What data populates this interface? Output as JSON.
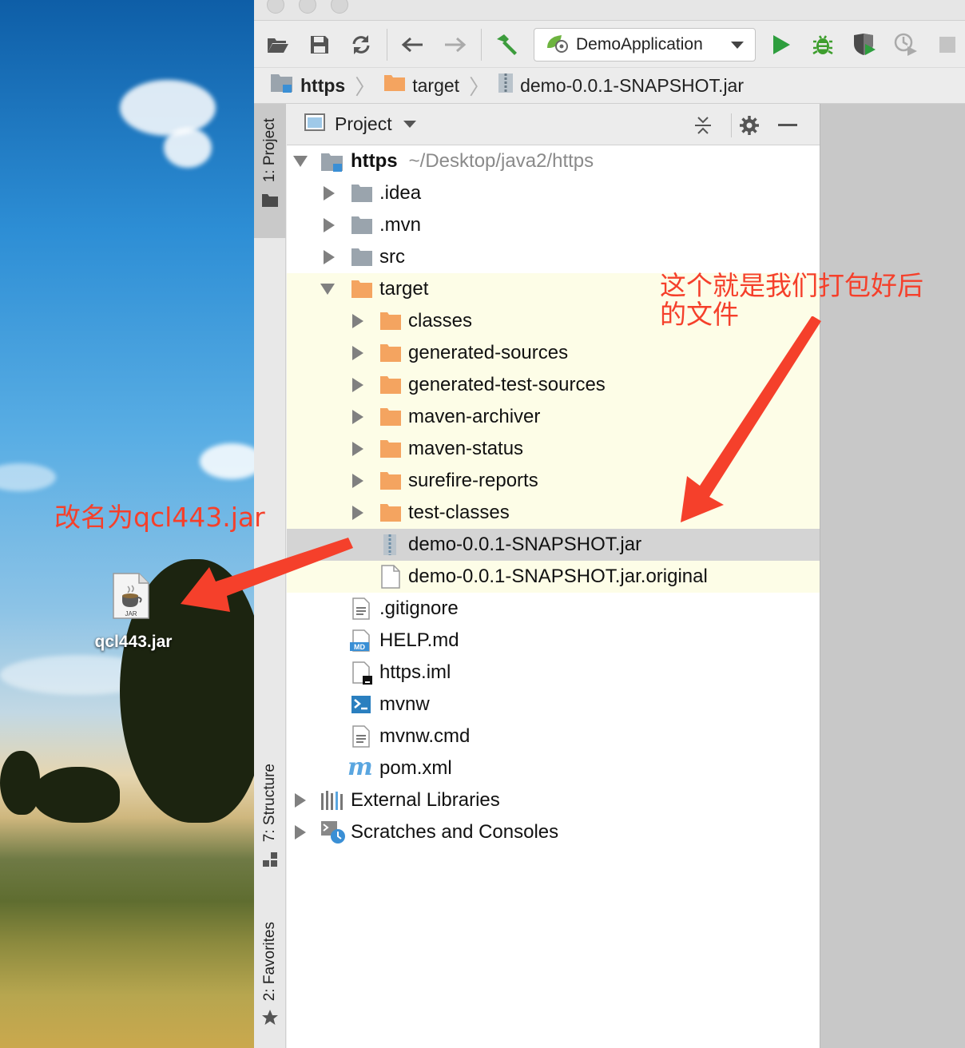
{
  "desktop": {
    "file_label": "qcl443.jar",
    "jar_badge": "JAR"
  },
  "toolbar": {
    "run_config": "DemoApplication"
  },
  "navbar": {
    "crumbs": [
      "https",
      "target",
      "demo-0.0.1-SNAPSHOT.jar"
    ]
  },
  "left_stripe": {
    "project_tab": "1: Project",
    "structure_tab": "7: Structure",
    "favorites_tab": "2: Favorites"
  },
  "panel": {
    "title": "Project"
  },
  "tree": {
    "root": {
      "name": "https",
      "path": "~/Desktop/java2/https"
    },
    "items": [
      ".idea",
      ".mvn",
      "src",
      "target",
      "classes",
      "generated-sources",
      "generated-test-sources",
      "maven-archiver",
      "maven-status",
      "surefire-reports",
      "test-classes",
      "demo-0.0.1-SNAPSHOT.jar",
      "demo-0.0.1-SNAPSHOT.jar.original",
      ".gitignore",
      "HELP.md",
      "https.iml",
      "mvnw",
      "mvnw.cmd",
      "pom.xml",
      "External Libraries",
      "Scratches and Consoles"
    ]
  },
  "annotations": {
    "packaged_note_line1": "这个就是我们打包好后",
    "packaged_note_line2": "的文件",
    "rename_note": "改名为qcl443.jar"
  },
  "colors": {
    "folder_orange": "#f4a460",
    "folder_gray": "#9aa4ad",
    "annotation_red": "#f5402b",
    "run_green": "#2e9e3e"
  }
}
